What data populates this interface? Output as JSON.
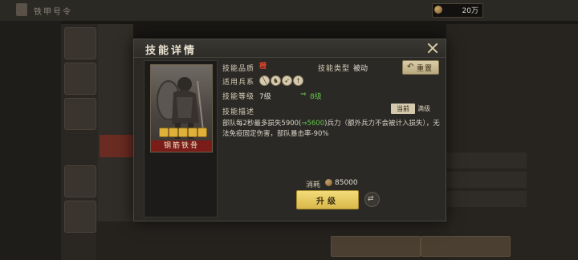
{
  "top_bar": {
    "title": "铁甲号令",
    "resource_value": "20万"
  },
  "dialog": {
    "title": "技能详情",
    "close_icon": "close-icon",
    "skill_card": {
      "name": "钢筋铁骨",
      "level_badges": 5
    },
    "quality_label": "技能品质",
    "quality_icon": "橙",
    "type_label": "技能类型",
    "type_value": "被动",
    "reset_label": "重置",
    "troop_label": "适用兵系",
    "troop_icons": [
      "spear-icon",
      "cavalry-icon",
      "archer-icon",
      "sword-icon"
    ],
    "level_label": "技能等级",
    "current_level": "7级",
    "next_level": "8级",
    "desc_label": "技能描述",
    "current_tag": "当前",
    "max_tag": "满级",
    "description": {
      "part1": "部队每2秒最多损失5900(",
      "arrow": "⇒",
      "highlight": "5600",
      "part2": ")兵力（额外兵力不会被计入损失），无法免疫固定伤害，部队暴击率-90%"
    },
    "cost_label": "消耗",
    "cost_value": "85000",
    "upgrade_label": "升级"
  },
  "colors": {
    "accent_gold": "#e0b13a",
    "green_highlight": "#65c44a",
    "card_red": "#7a1c18"
  }
}
